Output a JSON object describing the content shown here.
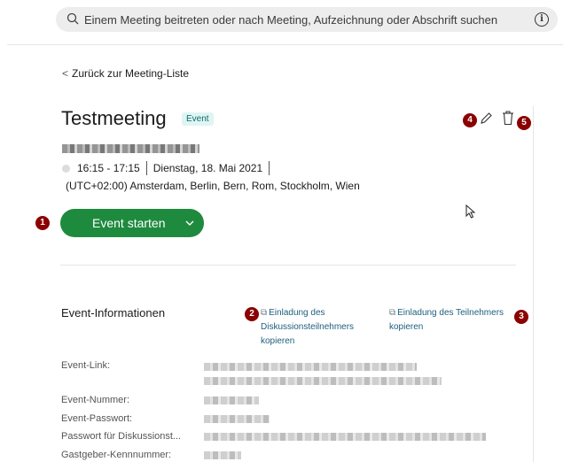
{
  "search": {
    "placeholder": "Einem Meeting beitreten oder nach Meeting, Aufzeichnung oder Abschrift suchen",
    "info_glyph": "i"
  },
  "back_link": {
    "chevron": "<",
    "label": "Zurück zur Meeting-Liste"
  },
  "meeting": {
    "title": "Testmeeting",
    "tag": "Event",
    "time": "16:15 - 17:15",
    "date": "Dienstag, 18. Mai 2021",
    "timezone": "(UTC+02:00) Amsterdam, Berlin, Bern, Rom, Stockholm, Wien"
  },
  "start_button": {
    "label": "Event starten"
  },
  "badges": {
    "b1": "1",
    "b2": "2",
    "b3": "3",
    "b4": "4",
    "b5": "5"
  },
  "event_info": {
    "section_title": "Event-Informationen",
    "copy_panelist": {
      "line1": "Einladung des",
      "line2": "Diskussionsteilnehmers",
      "line3": "kopieren"
    },
    "copy_attendee": {
      "line1": "Einladung des Teilnehmers",
      "line2": "kopieren"
    },
    "fields": {
      "link": "Event-Link:",
      "number": "Event-Nummer:",
      "password": "Event-Passwort:",
      "panelist_password": "Passwort für Diskussionst...",
      "host_pin": "Gastgeber-Kennnummer:"
    }
  },
  "icons": [
    "search-icon",
    "info-icon",
    "pencil-icon",
    "trash-icon",
    "chevron-down-icon",
    "copy-icon",
    "mouse-cursor-icon"
  ],
  "colors": {
    "primary_button": "#1e8a3e",
    "tag_bg": "#dff5f3",
    "tag_text": "#0b6b6b",
    "link": "#1d5e7e",
    "badge": "#8b0000"
  }
}
